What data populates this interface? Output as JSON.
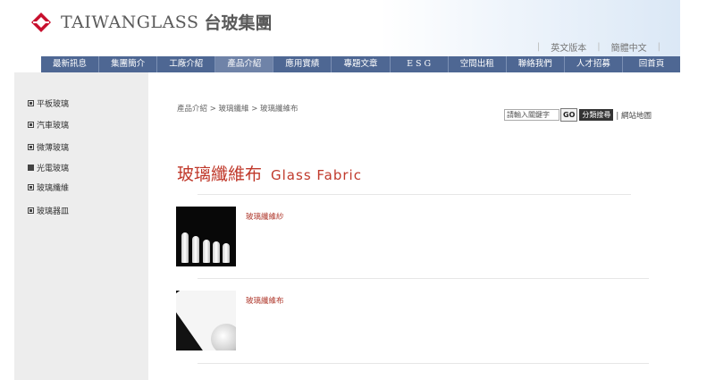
{
  "header": {
    "logo_text": "TAIWANGLASS",
    "logo_cn": "台玻集團",
    "lang_english": "英文版本",
    "lang_chinese": "簡體中文"
  },
  "nav": {
    "items": [
      "最新訊息",
      "集團簡介",
      "工廠介紹",
      "產品介紹",
      "應用實績",
      "專題文章",
      "E S G",
      "空間出租",
      "聯絡我們",
      "人才招募",
      "回首頁"
    ],
    "active_index": 3
  },
  "sidebar": {
    "items": [
      {
        "label": "平板玻璃"
      },
      {
        "label": "汽車玻璃"
      },
      {
        "label": "微薄玻璃"
      },
      {
        "label": "光電玻璃"
      },
      {
        "label": "玻璃纖維"
      },
      {
        "label": "玻璃器皿"
      }
    ]
  },
  "breadcrumb": "產品介紹 > 玻璃纖維 > 玻璃纖維布",
  "search": {
    "placeholder": "請輸入關鍵字",
    "go_label": "GO",
    "category_label": "分類搜尋",
    "sitemap_label": "網站地圖"
  },
  "page_title": {
    "cn": "玻璃纖維布",
    "en": "Glass Fabric"
  },
  "products": [
    {
      "label": "玻璃纖維紗",
      "image": "glass-fiber-yarn-bottles"
    },
    {
      "label": "玻璃纖維布",
      "image": "glass-fabric-roll"
    }
  ],
  "colors": {
    "nav_bg": "#4e6793",
    "accent_red": "#c0392b",
    "sidebar_bg": "#ededed"
  }
}
